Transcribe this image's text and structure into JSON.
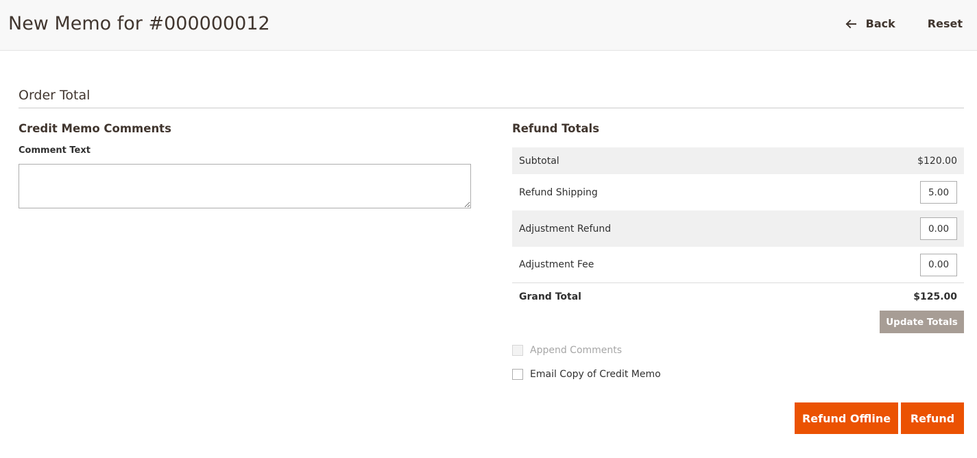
{
  "header": {
    "title": "New Memo for #000000012",
    "back_label": "Back",
    "reset_label": "Reset"
  },
  "section": {
    "title": "Order Total"
  },
  "comments": {
    "title": "Credit Memo Comments",
    "comment_label": "Comment Text",
    "comment_value": ""
  },
  "refund_totals": {
    "title": "Refund Totals",
    "subtotal_label": "Subtotal",
    "subtotal_value": "$120.00",
    "shipping_label": "Refund Shipping",
    "shipping_value": "5.00",
    "adjustment_refund_label": "Adjustment Refund",
    "adjustment_refund_value": "0.00",
    "adjustment_fee_label": "Adjustment Fee",
    "adjustment_fee_value": "0.00",
    "grand_total_label": "Grand Total",
    "grand_total_value": "$125.00",
    "update_label": "Update Totals"
  },
  "options": {
    "append_comments_label": "Append Comments",
    "append_comments_checked": false,
    "append_comments_disabled": true,
    "email_copy_label": "Email Copy of Credit Memo",
    "email_copy_checked": false
  },
  "actions": {
    "refund_offline_label": "Refund Offline",
    "refund_label": "Refund"
  },
  "colors": {
    "primary": "#eb5202",
    "secondary_button": "#a79d95",
    "header_bg": "#f8f8f8",
    "row_shade": "#f0f0f0"
  }
}
